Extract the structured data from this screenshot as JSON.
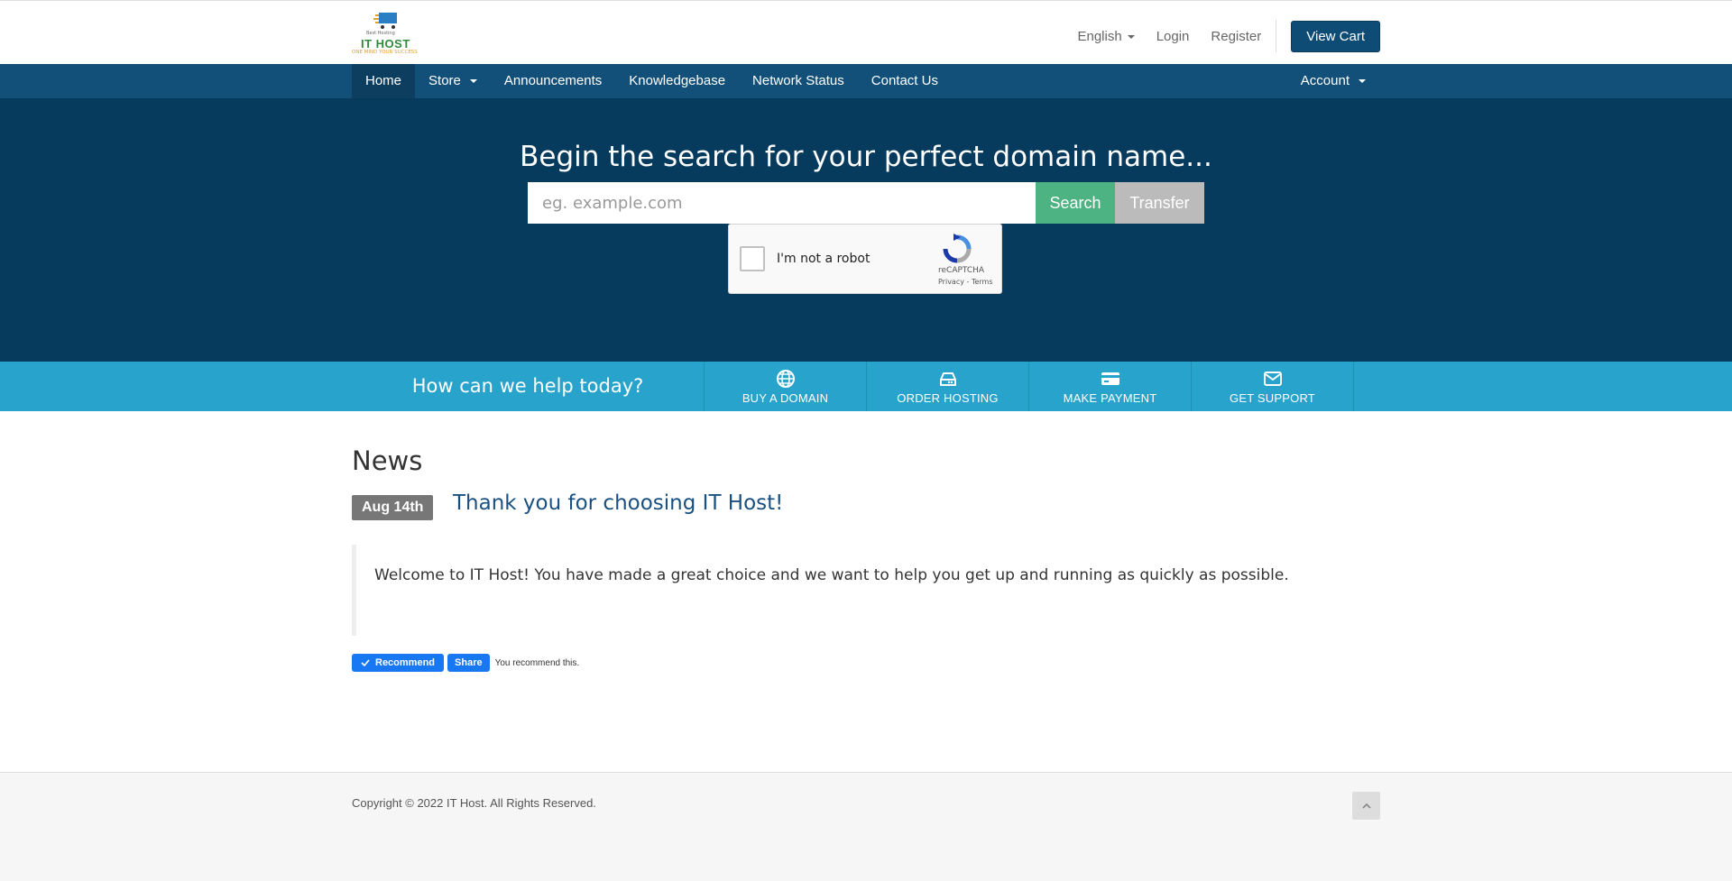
{
  "header": {
    "logo": {
      "tagline": "Best Hosting",
      "brand": "IT HOST",
      "slogan": "ONE MIND YOUR SUCCESS"
    },
    "language_label": "English",
    "login_label": "Login",
    "register_label": "Register",
    "view_cart_label": "View Cart"
  },
  "nav": {
    "items": [
      {
        "label": "Home",
        "active": true
      },
      {
        "label": "Store",
        "dropdown": true
      },
      {
        "label": "Announcements"
      },
      {
        "label": "Knowledgebase"
      },
      {
        "label": "Network Status"
      },
      {
        "label": "Contact Us"
      }
    ],
    "account_label": "Account"
  },
  "hero": {
    "title": "Begin the search for your perfect domain name...",
    "search_placeholder": "eg. example.com",
    "search_button": "Search",
    "transfer_button": "Transfer",
    "captcha": {
      "label": "I'm not a robot",
      "brand": "reCAPTCHA",
      "links": "Privacy - Terms"
    }
  },
  "help": {
    "question": "How can we help today?",
    "tiles": [
      {
        "label": "BUY A DOMAIN",
        "icon": "globe-icon"
      },
      {
        "label": "ORDER HOSTING",
        "icon": "server-icon"
      },
      {
        "label": "MAKE PAYMENT",
        "icon": "credit-card-icon"
      },
      {
        "label": "GET SUPPORT",
        "icon": "envelope-icon"
      }
    ]
  },
  "news": {
    "heading": "News",
    "date": "Aug 14th",
    "title": "Thank you for choosing IT Host!",
    "body": "Welcome to IT Host! You have made a great choice and we want to help you get up and running as quickly as possible.",
    "recommend_label": "Recommend",
    "share_label": "Share",
    "recommend_text": "You recommend this."
  },
  "footer": {
    "copyright": "Copyright © 2022 IT Host. All Rights Reserved."
  },
  "colors": {
    "primary": "#0f4c75",
    "nav_bg": "#12507a",
    "hero_bg": "#063b5e",
    "help_bg": "#28a3cc",
    "search_green": "#4db382",
    "transfer_gray": "#bbbbbb"
  }
}
